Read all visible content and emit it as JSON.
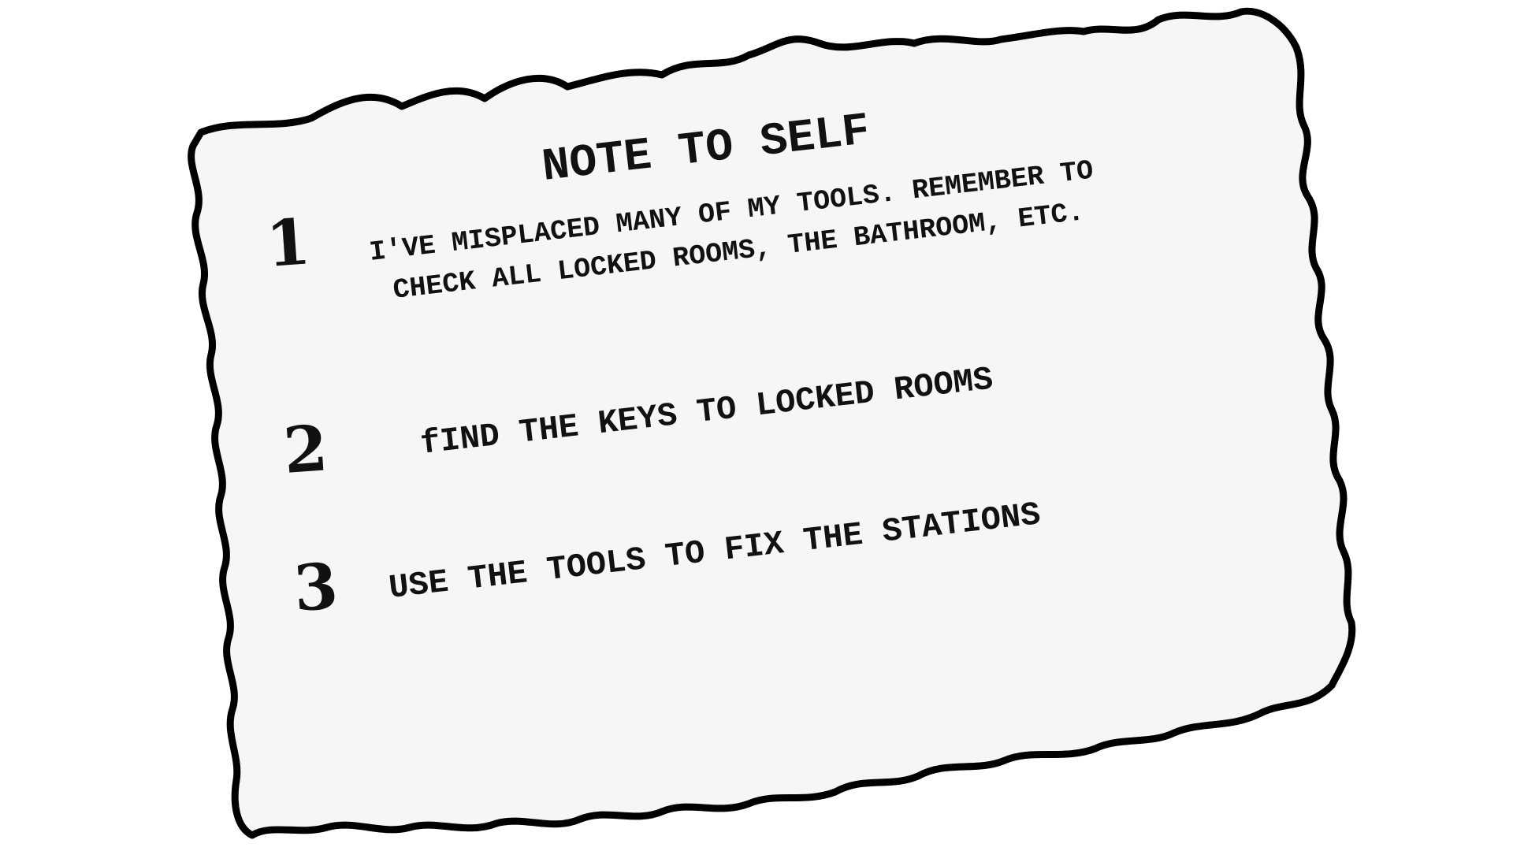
{
  "note": {
    "title": "NOTE TO SELF",
    "items": [
      {
        "number": "1",
        "line1": "I'VE MISPLACED MANY OF MY TOOLS. REMEMBER TO",
        "line2": "CHECK ALL LOCKED ROOMS, THE BATHROOM, ETC."
      },
      {
        "number": "2",
        "line1": "fIND THE KEYS TO LOCKED ROOMS"
      },
      {
        "number": "3",
        "line1": "USE THE TOOLS TO FIX THE STATIONS"
      }
    ]
  },
  "colors": {
    "paper": "#f6f6f6",
    "rule_line": "#2323d8",
    "margin_line": "#e51c1c",
    "outline": "#000000"
  }
}
